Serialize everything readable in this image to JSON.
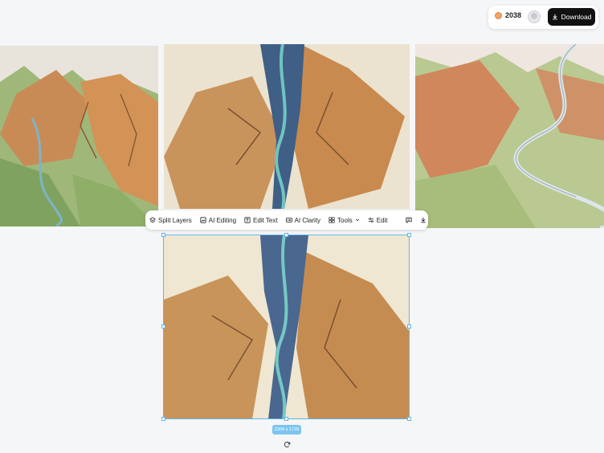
{
  "header": {
    "credits": "2038",
    "download_label": "Download"
  },
  "toolbar": {
    "split_layers": "Split Layers",
    "ai_editing": "AI Editing",
    "edit_text": "Edit Text",
    "ai_clarity": "AI Clarity",
    "tools": "Tools",
    "edit": "Edit"
  },
  "selection": {
    "size_label": "2304 x 1728"
  },
  "images": [
    {
      "name": "watercolor valley with river and peaks"
    },
    {
      "name": "watercolor canyon aerial view"
    },
    {
      "name": "watercolor winding river valley"
    },
    {
      "name": "watercolor canyon aerial view (selected)"
    }
  ],
  "colors": {
    "accent": "#62b6e9",
    "button_dark": "#111111",
    "background": "#f5f6f8"
  }
}
